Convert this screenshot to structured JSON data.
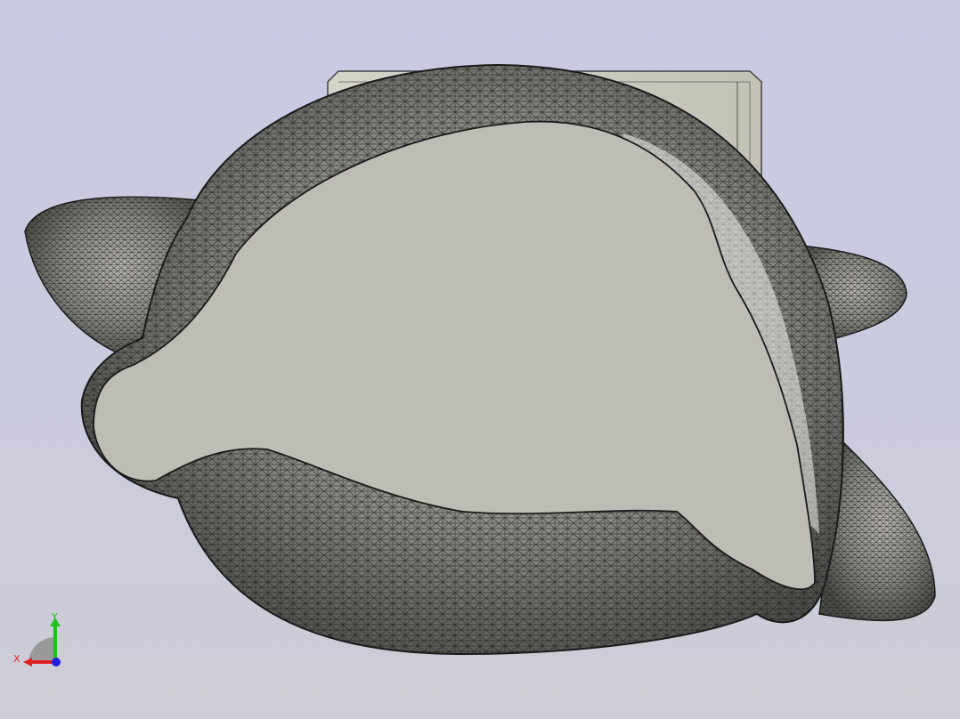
{
  "viewer": {
    "background_top": "#c9c9e3",
    "background_bottom": "#cdcdd6",
    "mesh_color": "#1a1a1a",
    "surface_color": "#8a8a84",
    "cut_face_color": "#bdbdb5",
    "plate_color": "#c8c8bc"
  },
  "triad": {
    "x_label": "X",
    "y_label": "Y",
    "x_color": "#e02020",
    "y_color": "#20c020",
    "z_color": "#2020e0"
  }
}
